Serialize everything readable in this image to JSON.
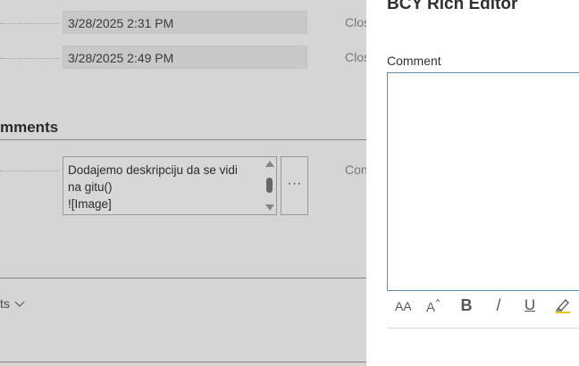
{
  "background": {
    "rows": [
      {
        "value": "3/28/2025 2:31 PM",
        "right_label": "Clos"
      },
      {
        "value": "3/28/2025 2:49 PM",
        "right_label": "Clos"
      }
    ],
    "section_title": "mments",
    "comment": {
      "lines": [
        "Dodajemo deskripciju da se vidi",
        "na gitu()",
        "![Image]"
      ],
      "right_label": "Con",
      "more_label": "···"
    },
    "show_more_label": "ts"
  },
  "panel": {
    "title": "BCY Rich Editor",
    "field_label": "Comment",
    "editor_value": "",
    "toolbar": {
      "font_size_label": "AA",
      "grow_font_label": "A",
      "bold_label": "B",
      "italic_label": "/",
      "underline_label": "U",
      "highlight_color": "#e6c700"
    }
  }
}
